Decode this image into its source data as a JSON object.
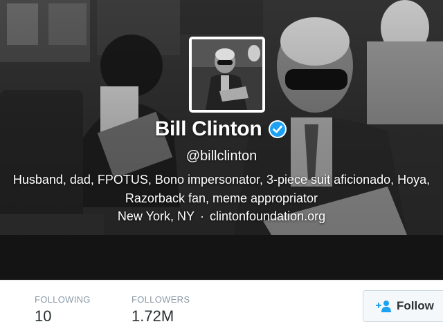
{
  "profile": {
    "name": "Bill Clinton",
    "screen_name": "@billclinton",
    "bio_line1": "Husband, dad, FPOTUS, Bono impersonator, 3-piece suit aficionado, Hoya,",
    "bio_line2": "Razorback fan, meme appropriator",
    "location": "New York, NY",
    "separator": "·",
    "website": "clintonfoundation.org",
    "verified_icon": "verified-badge-icon"
  },
  "stats": {
    "following_label": "FOLLOWING",
    "following_value": "10",
    "followers_label": "FOLLOWERS",
    "followers_value": "1.72M"
  },
  "actions": {
    "follow_label": "Follow",
    "follow_icon": "add-user-icon"
  },
  "colors": {
    "verified": "#1da1f2",
    "stat_label": "#8899a6",
    "stat_value": "#292f33",
    "follow_icon": "#1da1f2"
  }
}
